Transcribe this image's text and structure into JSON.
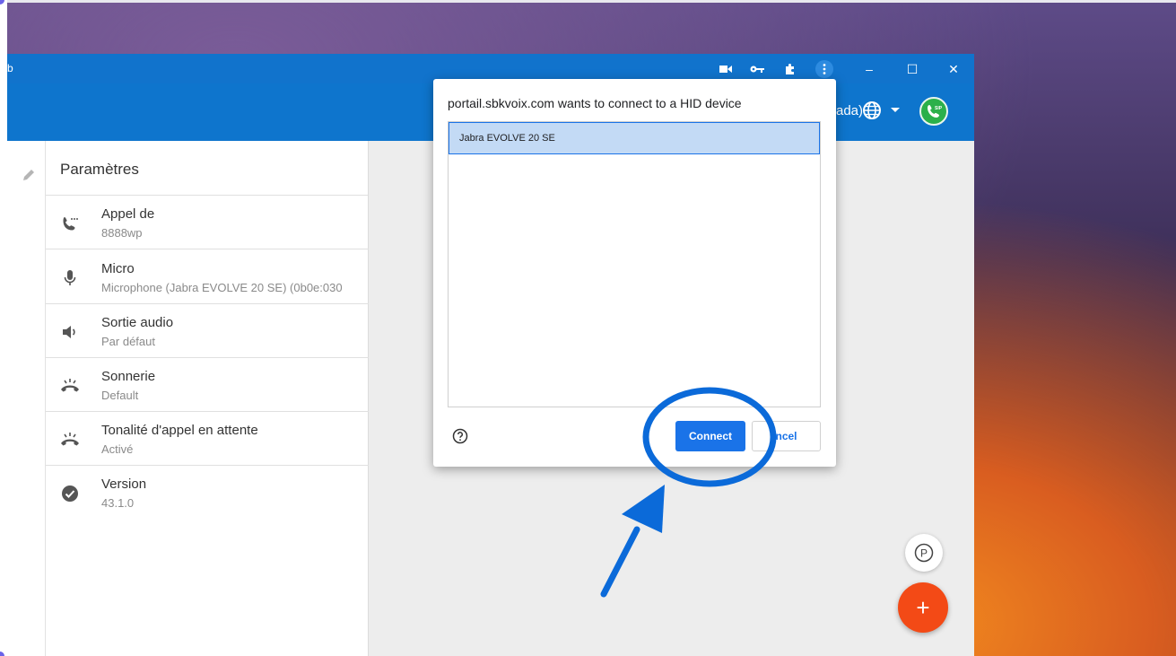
{
  "window": {
    "title_fragment": "b",
    "controls": {
      "minimize": "–",
      "maximize": "☐",
      "close": "✕"
    }
  },
  "toolbar": {
    "icons": [
      "video-camera-icon",
      "key-icon",
      "puzzle-extension-icon",
      "more-vert-icon"
    ]
  },
  "appbar": {
    "language_fragment": "ada)",
    "accent_color": "#0e75cd",
    "sip_badge_color": "#2bb04a"
  },
  "settings": {
    "title": "Paramètres",
    "items": [
      {
        "label": "Appel de",
        "value": "8888wp",
        "icon": "phone-dialpad-icon"
      },
      {
        "label": "Micro",
        "value": "Microphone (Jabra EVOLVE 20 SE) (0b0e:030",
        "icon": "microphone-icon"
      },
      {
        "label": "Sortie audio",
        "value": "Par défaut",
        "icon": "speaker-icon"
      },
      {
        "label": "Sonnerie",
        "value": "Default",
        "icon": "ringing-phone-icon"
      },
      {
        "label": "Tonalité d'appel en attente",
        "value": "Activé",
        "icon": "ringing-phone-icon"
      },
      {
        "label": "Version",
        "value": "43.1.0",
        "icon": "check-circle-icon"
      }
    ]
  },
  "dialog": {
    "title": "portail.sbkvoix.com wants to connect to a HID device",
    "devices": [
      "Jabra EVOLVE 20 SE"
    ],
    "connect_label": "Connect",
    "cancel_label": "ncel"
  },
  "fabs": {
    "parking_label": "P",
    "add_label": "+"
  },
  "annotation_color": "#0b6ad9"
}
